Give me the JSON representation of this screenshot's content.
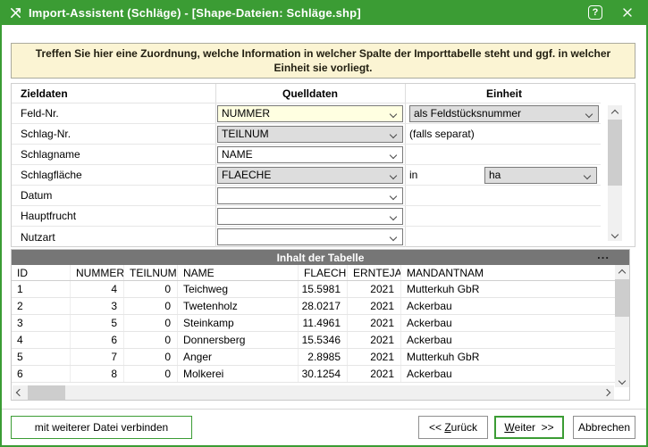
{
  "window": {
    "title": "Import-Assistent (Schläge) - [Shape-Dateien: Schläge.shp]",
    "help_glyph": "?"
  },
  "instruction": "Treffen Sie hier eine Zuordnung, welche Information in welcher Spalte der Importtabelle steht und ggf. in welcher Einheit sie vorliegt.",
  "mapping": {
    "headers": {
      "target": "Zieldaten",
      "source": "Quelldaten",
      "unit": "Einheit"
    },
    "rows": [
      {
        "label": "Feld-Nr.",
        "source": "NUMMER",
        "unit": "als Feldstücksnummer"
      },
      {
        "label": "Schlag-Nr.",
        "source": "TEILNUM",
        "unit": "(falls separat)"
      },
      {
        "label": "Schlagname",
        "source": "NAME",
        "unit": ""
      },
      {
        "label": "Schlagfläche",
        "source": "FLAECHE",
        "unit_prefix": "in",
        "unit": "ha"
      },
      {
        "label": "Datum",
        "source": "",
        "unit": ""
      },
      {
        "label": "Hauptfrucht",
        "source": "",
        "unit": ""
      },
      {
        "label": "Nutzart",
        "source": "",
        "unit": ""
      }
    ]
  },
  "table": {
    "title": "Inhalt der Tabelle",
    "more_label": "...",
    "columns": [
      "ID",
      "NUMMER",
      "TEILNUM",
      "NAME",
      "FLAECHE",
      "ERNTEJAHR",
      "MANDANTNAM"
    ],
    "rows": [
      [
        "1",
        "4",
        "0",
        "Teichweg",
        "15.5981",
        "2021",
        "Mutterkuh GbR"
      ],
      [
        "2",
        "3",
        "0",
        "Twetenholz",
        "28.0217",
        "2021",
        "Ackerbau"
      ],
      [
        "3",
        "5",
        "0",
        "Steinkamp",
        "11.4961",
        "2021",
        "Ackerbau"
      ],
      [
        "4",
        "6",
        "0",
        "Donnersberg",
        "15.5346",
        "2021",
        "Ackerbau"
      ],
      [
        "5",
        "7",
        "0",
        "Anger",
        "2.8985",
        "2021",
        "Mutterkuh GbR"
      ],
      [
        "6",
        "8",
        "0",
        "Molkerei",
        "30.1254",
        "2021",
        "Ackerbau"
      ]
    ]
  },
  "footer": {
    "connect_label": "mit weiterer Datei verbinden",
    "back_prefix": "<< ",
    "back_mnemonic": "Z",
    "back_rest": "urück",
    "next_mnemonic": "W",
    "next_rest": "eiter",
    "next_suffix": "  >>",
    "cancel_label": "Abbrechen"
  },
  "colors": {
    "accent_green": "#3B9C34",
    "info_banner_yellow": "#FBF4D3",
    "select_highlight_yellow": "#FFFFE1",
    "select_gray": "#DDDDDD",
    "table_header_gray": "#767676"
  }
}
